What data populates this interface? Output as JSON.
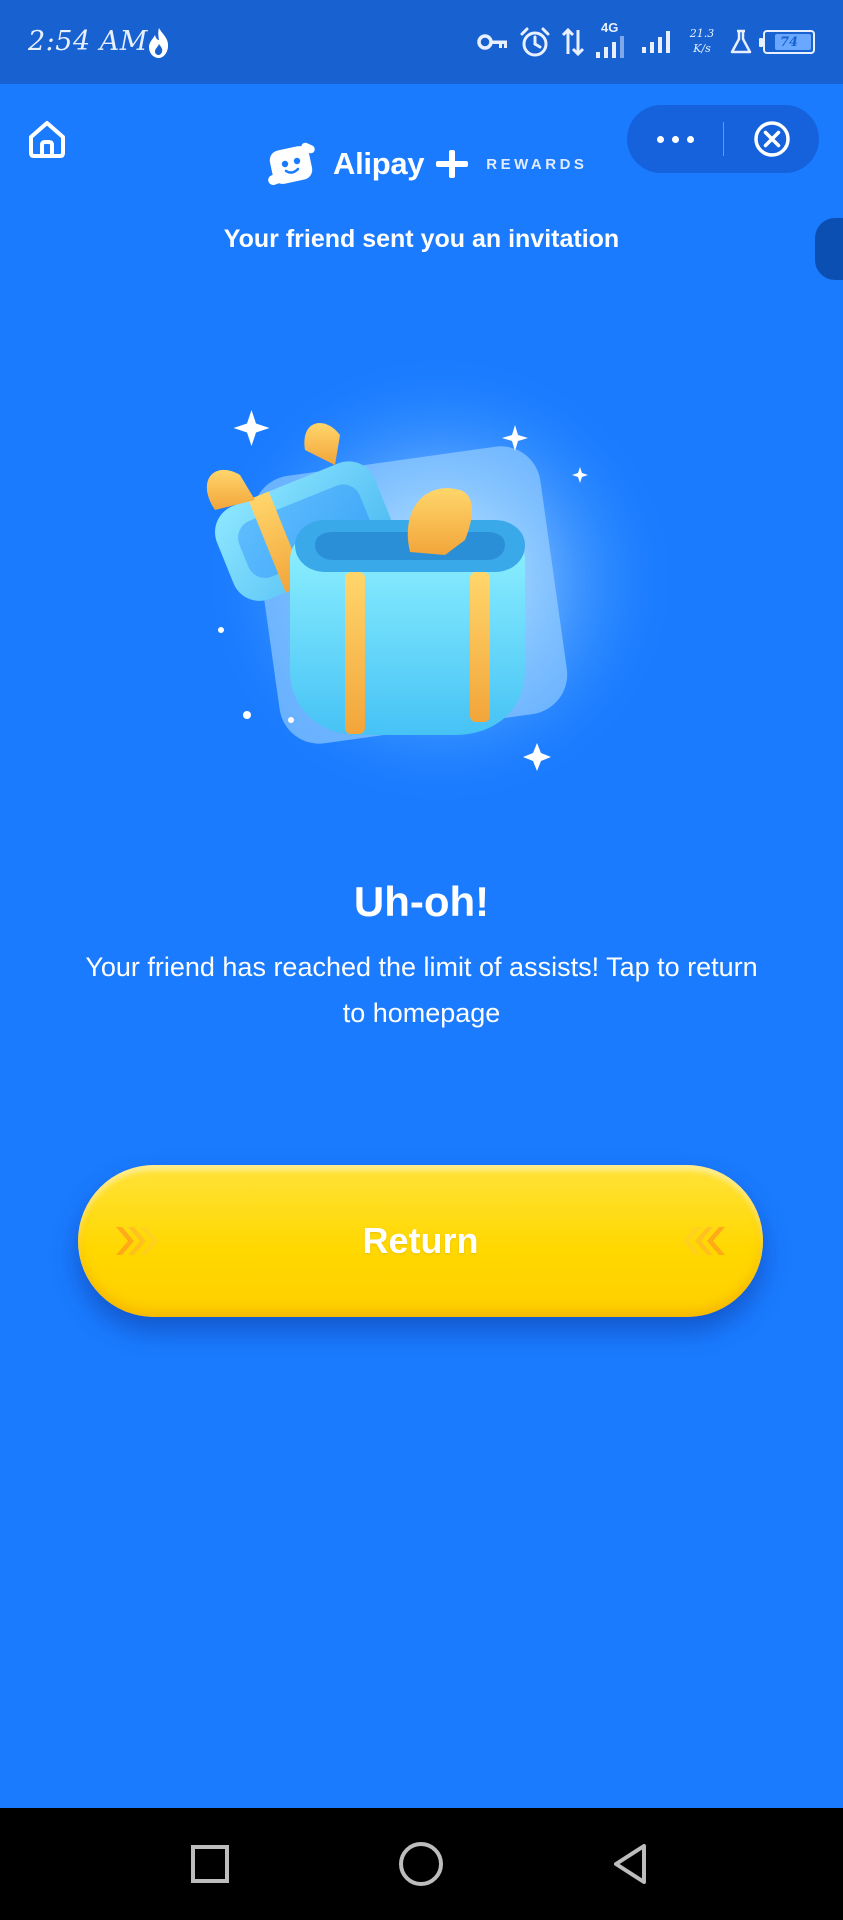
{
  "status_bar": {
    "time": "2:54 AM",
    "network_type": "4G",
    "speed_value": "21.3",
    "speed_unit": "K/s",
    "battery_level": "74",
    "icons": [
      "flame-icon",
      "vpn-key-icon",
      "alarm-icon",
      "data-transfer-icon",
      "signal-icon",
      "signal-icon",
      "lab-flask-icon",
      "battery-icon"
    ]
  },
  "header": {
    "brand_name": "Alipay",
    "brand_suffix": "REWARDS",
    "subtitle": "Your friend sent you an invitation"
  },
  "content": {
    "title": "Uh-oh!",
    "message": "Your friend has reached the limit of assists! Tap to return to homepage"
  },
  "actions": {
    "return_label": "Return"
  },
  "colors": {
    "background": "#1a7bff",
    "status_bar": "#1761d0",
    "button_yellow": "#ffd800",
    "chevron_orange": "#ff9a1f",
    "nav_bar": "#000000"
  },
  "nav_bar": {
    "buttons": [
      "recent-apps-icon",
      "home-circle-icon",
      "back-triangle-icon"
    ]
  }
}
